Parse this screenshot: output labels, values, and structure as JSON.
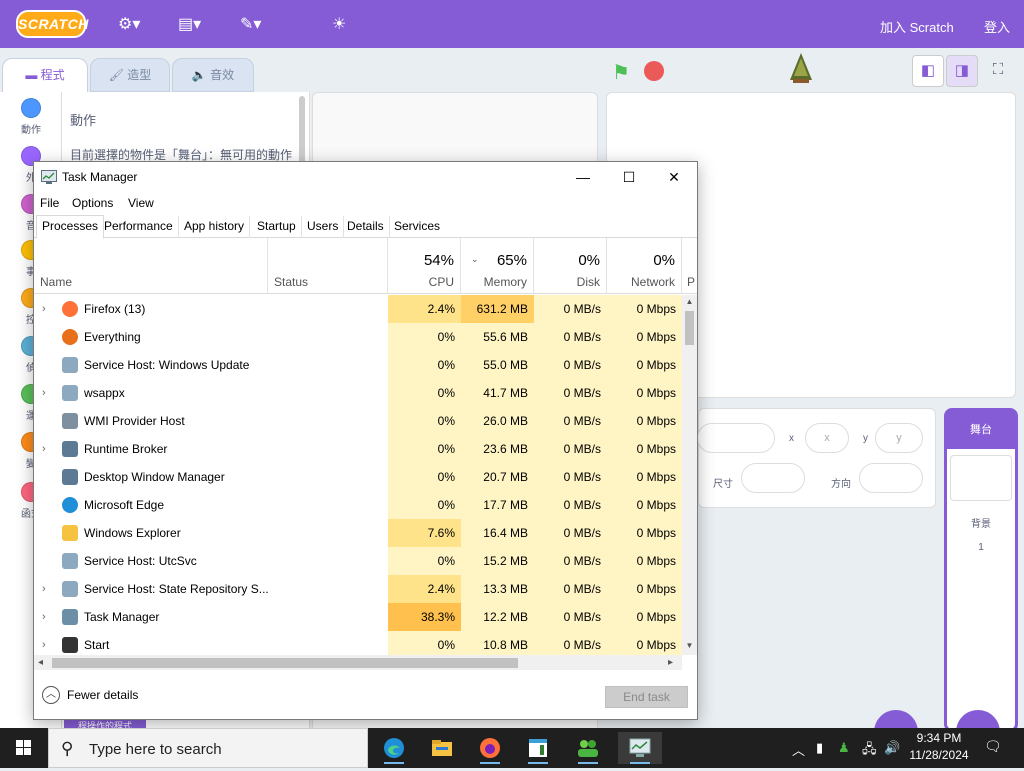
{
  "scratch": {
    "logo": "SCRATCH",
    "join": "加入 Scratch",
    "signin": "登入",
    "tabs": [
      "程式",
      "造型",
      "音效"
    ],
    "categories": [
      {
        "label": "動作",
        "color": "#4c97ff"
      },
      {
        "label": "外",
        "color": "#9966ff"
      },
      {
        "label": "音",
        "color": "#cf63cf"
      },
      {
        "label": "事",
        "color": "#ffbf00"
      },
      {
        "label": "控",
        "color": "#ffab19"
      },
      {
        "label": "偵",
        "color": "#5cb1d6"
      },
      {
        "label": "運",
        "color": "#59c059"
      },
      {
        "label": "變",
        "color": "#ff8c1a"
      },
      {
        "label": "函式",
        "color": "#ff6680"
      }
    ],
    "blocks_title": "動作",
    "blocks_message": "目前選擇的物件是「舞台」：無可用的動作",
    "x_label": "x",
    "y_label": "y",
    "x_placeholder": "x",
    "y_placeholder": "y",
    "size_label": "尺寸",
    "direction_label": "方向",
    "stage_label": "舞台",
    "backdrops_label": "背景",
    "backdrops_count": "1",
    "bottom_tag": "程操作的程式"
  },
  "taskmgr": {
    "title": "Task Manager",
    "menu": [
      "File",
      "Options",
      "View"
    ],
    "tabs": [
      "Processes",
      "Performance",
      "App history",
      "Startup",
      "Users",
      "Details",
      "Services"
    ],
    "active_tab": "Processes",
    "columns": {
      "name": "Name",
      "status": "Status",
      "cpu": {
        "pct": "54%",
        "label": "CPU"
      },
      "memory": {
        "pct": "65%",
        "label": "Memory"
      },
      "disk": {
        "pct": "0%",
        "label": "Disk"
      },
      "network": {
        "pct": "0%",
        "label": "Network"
      },
      "power": "P"
    },
    "processes": [
      {
        "name": "Firefox (13)",
        "expand": true,
        "icon": "firefox-icon",
        "cpu": "2.4%",
        "memory": "631.2 MB",
        "disk": "0 MB/s",
        "network": "0 Mbps"
      },
      {
        "name": "Everything",
        "expand": false,
        "icon": "everything-icon",
        "cpu": "0%",
        "memory": "55.6 MB",
        "disk": "0 MB/s",
        "network": "0 Mbps"
      },
      {
        "name": "Service Host: Windows Update",
        "expand": false,
        "icon": "service-icon",
        "cpu": "0%",
        "memory": "55.0 MB",
        "disk": "0 MB/s",
        "network": "0 Mbps"
      },
      {
        "name": "wsappx",
        "expand": true,
        "icon": "service-icon",
        "cpu": "0%",
        "memory": "41.7 MB",
        "disk": "0 MB/s",
        "network": "0 Mbps"
      },
      {
        "name": "WMI Provider Host",
        "expand": false,
        "icon": "wmi-icon",
        "cpu": "0%",
        "memory": "26.0 MB",
        "disk": "0 MB/s",
        "network": "0 Mbps"
      },
      {
        "name": "Runtime Broker",
        "expand": true,
        "icon": "window-icon",
        "cpu": "0%",
        "memory": "23.6 MB",
        "disk": "0 MB/s",
        "network": "0 Mbps"
      },
      {
        "name": "Desktop Window Manager",
        "expand": false,
        "icon": "window-icon",
        "cpu": "0%",
        "memory": "20.7 MB",
        "disk": "0 MB/s",
        "network": "0 Mbps"
      },
      {
        "name": "Microsoft Edge",
        "expand": false,
        "icon": "edge-icon",
        "cpu": "0%",
        "memory": "17.7 MB",
        "disk": "0 MB/s",
        "network": "0 Mbps"
      },
      {
        "name": "Windows Explorer",
        "expand": false,
        "icon": "explorer-icon",
        "cpu": "7.6%",
        "memory": "16.4 MB",
        "disk": "0 MB/s",
        "network": "0 Mbps"
      },
      {
        "name": "Service Host: UtcSvc",
        "expand": false,
        "icon": "service-icon",
        "cpu": "0%",
        "memory": "15.2 MB",
        "disk": "0 MB/s",
        "network": "0 Mbps"
      },
      {
        "name": "Service Host: State Repository S...",
        "expand": true,
        "icon": "service-icon",
        "cpu": "2.4%",
        "memory": "13.3 MB",
        "disk": "0 MB/s",
        "network": "0 Mbps"
      },
      {
        "name": "Task Manager",
        "expand": true,
        "icon": "taskmgr-icon",
        "cpu": "38.3%",
        "memory": "12.2 MB",
        "disk": "0 MB/s",
        "network": "0 Mbps"
      },
      {
        "name": "Start",
        "expand": true,
        "icon": "start-app-icon",
        "cpu": "0%",
        "memory": "10.8 MB",
        "disk": "0 MB/s",
        "network": "0 Mbps"
      }
    ],
    "fewer_details": "Fewer details",
    "end_task": "End task"
  },
  "taskbar": {
    "search_placeholder": "Type here to search",
    "apps": [
      "edge-icon",
      "file-explorer-icon",
      "firefox-icon",
      "notepad-icon",
      "people-icon",
      "task-manager-icon"
    ],
    "time": "9:34 PM",
    "date": "11/28/2024"
  },
  "colors": {
    "scratch_purple": "#855cd6",
    "heat_low": "#fff4c4",
    "heat_mid": "#ffe38a",
    "heat_high": "#ffd066",
    "heat_hot": "#ffc04d"
  }
}
